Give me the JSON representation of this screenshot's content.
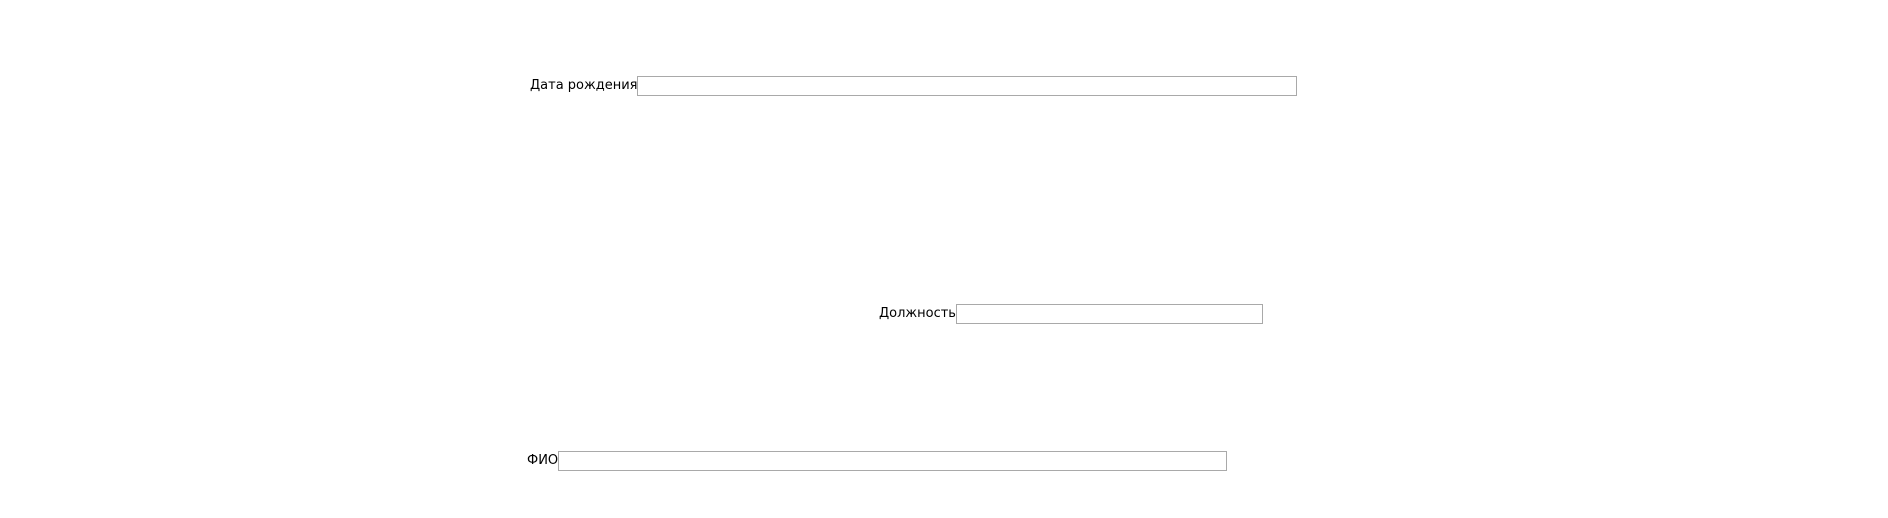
{
  "form": {
    "birthdate": {
      "label": "Дата рождения",
      "value": ""
    },
    "position": {
      "label": "Должность",
      "value": ""
    },
    "fullname": {
      "label": "ФИО",
      "value": ""
    }
  }
}
